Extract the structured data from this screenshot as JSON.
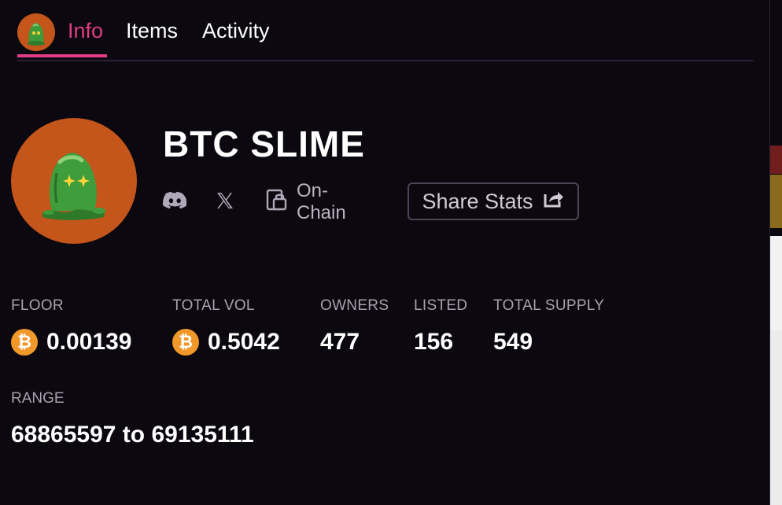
{
  "tabs": [
    {
      "label": "Info",
      "active": true
    },
    {
      "label": "Items",
      "active": false
    },
    {
      "label": "Activity",
      "active": false
    }
  ],
  "collection": {
    "name": "BTC SLIME",
    "onchain_label": "On-Chain",
    "share_label": "Share Stats",
    "icons": [
      "discord-icon",
      "x-icon",
      "lock-icon",
      "share-icon"
    ]
  },
  "stats": {
    "floor": {
      "label": "FLOOR",
      "value": "0.00139",
      "currency": "₿"
    },
    "total_vol": {
      "label": "TOTAL VOL",
      "value": "0.5042",
      "currency": "₿"
    },
    "owners": {
      "label": "OWNERS",
      "value": "477"
    },
    "listed": {
      "label": "LISTED",
      "value": "156"
    },
    "total_supply": {
      "label": "TOTAL SUPPLY",
      "value": "549"
    }
  },
  "range": {
    "label": "RANGE",
    "value": "68865597 to 69135111"
  },
  "colors": {
    "accent": "#e23d86",
    "avatar_bg": "#c4551b",
    "btc": "#f0982a",
    "background": "#0b080f"
  }
}
